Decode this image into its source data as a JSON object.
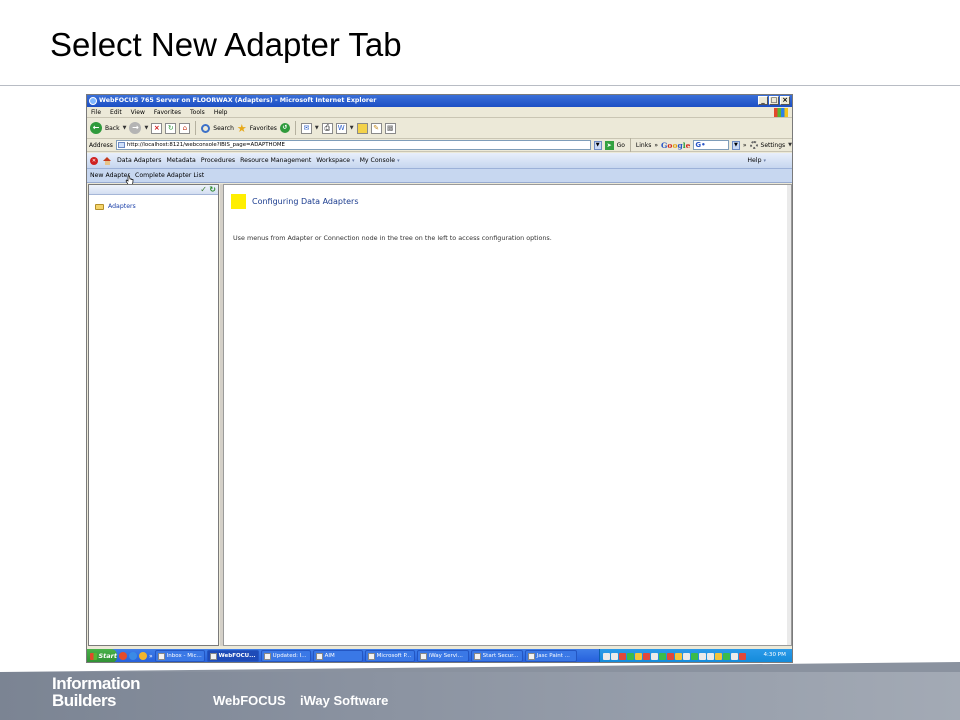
{
  "slide": {
    "title": "Select New Adapter Tab",
    "footer_logo_line1": "Information",
    "footer_logo_line2": "Builders",
    "footer_products": [
      "WebFOCUS",
      "iWay Software"
    ]
  },
  "window": {
    "title": "WebFOCUS 765 Server on FLOORWAX (Adapters) - Microsoft Internet Explorer",
    "buttons": [
      "_",
      "□",
      "×"
    ]
  },
  "menubar": [
    "File",
    "Edit",
    "View",
    "Favorites",
    "Tools",
    "Help"
  ],
  "toolbar": {
    "back": "Back",
    "search": "Search",
    "favorites": "Favorites"
  },
  "address": {
    "label": "Address",
    "url": "http://localhost:8121/webconsole?IBIS_page=ADAPTHOME",
    "go": "Go",
    "links": "Links",
    "more": "»",
    "google_letters": [
      "G",
      "o",
      "o",
      "g",
      "l",
      "e"
    ],
    "google_field": "G•",
    "settings": "Settings"
  },
  "appnav": {
    "items": [
      "Data Adapters",
      "Metadata",
      "Procedures",
      "Resource Management",
      "Workspace",
      "My Console"
    ],
    "dropdown_marker": "▾",
    "help": "Help"
  },
  "subnav": {
    "items": [
      "New Adapter",
      "Complete Adapter List"
    ]
  },
  "tree": {
    "root": "Adapters"
  },
  "content": {
    "heading": "Configuring Data Adapters",
    "text": "Use menus from Adapter or Connection node in the tree on the left to access configuration options."
  },
  "taskbar": {
    "start": "Start",
    "more": "»",
    "tasks": [
      "Inbox - Mic...",
      "WebFOCU...",
      "Updated: I...",
      "AIM",
      "Microsoft P...",
      "iWay Servi...",
      "Start Secur...",
      "Jasc Paint ..."
    ],
    "active_task": 1,
    "clock": "4:30 PM"
  },
  "colors": {
    "nav_bg": "#c6d6ef",
    "heading": "#1b3c8f",
    "marker": "#ffee00",
    "taskbar": "#245edb"
  }
}
